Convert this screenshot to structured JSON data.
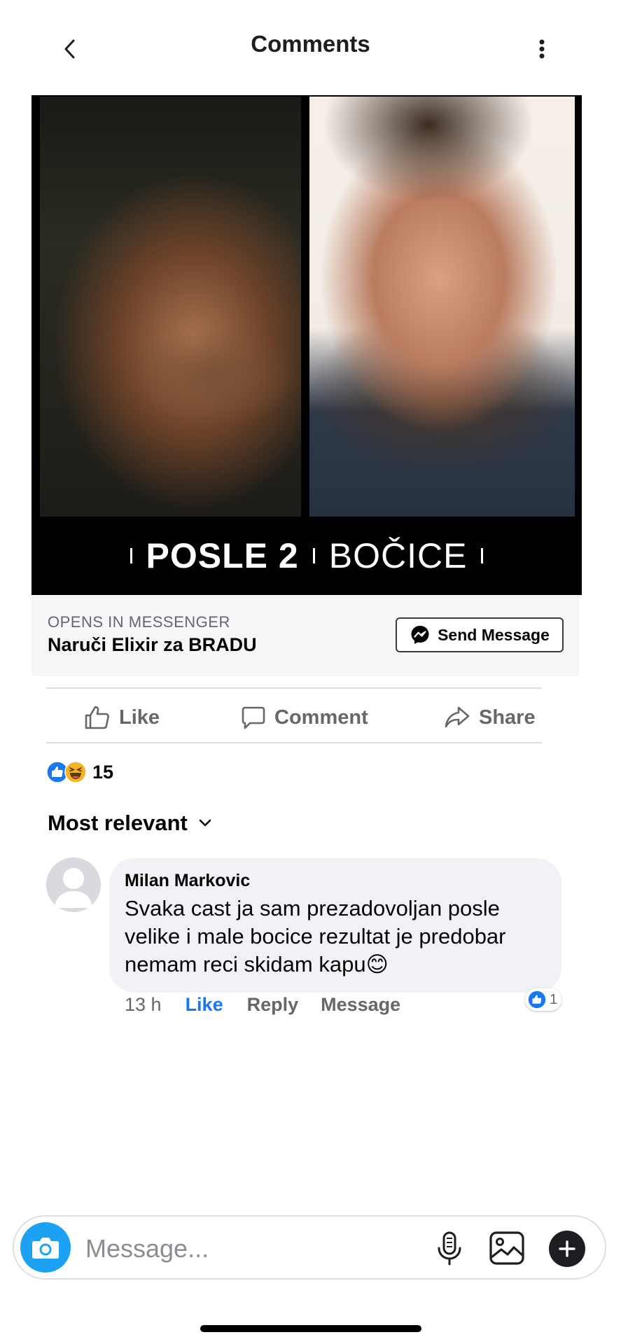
{
  "header": {
    "title": "Comments",
    "back_icon": "chevron-left-icon",
    "more_icon": "more-vertical-icon"
  },
  "ad": {
    "caption_bold": "POSLE 2",
    "caption_light": "BOČICE",
    "cta_subtitle": "OPENS IN MESSENGER",
    "cta_title": "Naruči Elixir za BRADU",
    "send_button_label": "Send Message"
  },
  "actions": {
    "like": "Like",
    "comment": "Comment",
    "share": "Share"
  },
  "reactions": {
    "count": "15",
    "types": [
      "like",
      "haha"
    ]
  },
  "sort": {
    "label": "Most relevant"
  },
  "comment": {
    "author": "Milan Markovic",
    "text": "Svaka cast ja sam prezadovoljan posle velike i male bocice rezultat je predobar nemam reci skidam kapu😊",
    "time": "13 h",
    "like_label": "Like",
    "reply_label": "Reply",
    "message_label": "Message",
    "reaction_count": "1"
  },
  "composer": {
    "placeholder": "Message..."
  },
  "colors": {
    "accent": "#1877f2",
    "camera": "#1da1f2",
    "text_secondary": "#65676b"
  }
}
